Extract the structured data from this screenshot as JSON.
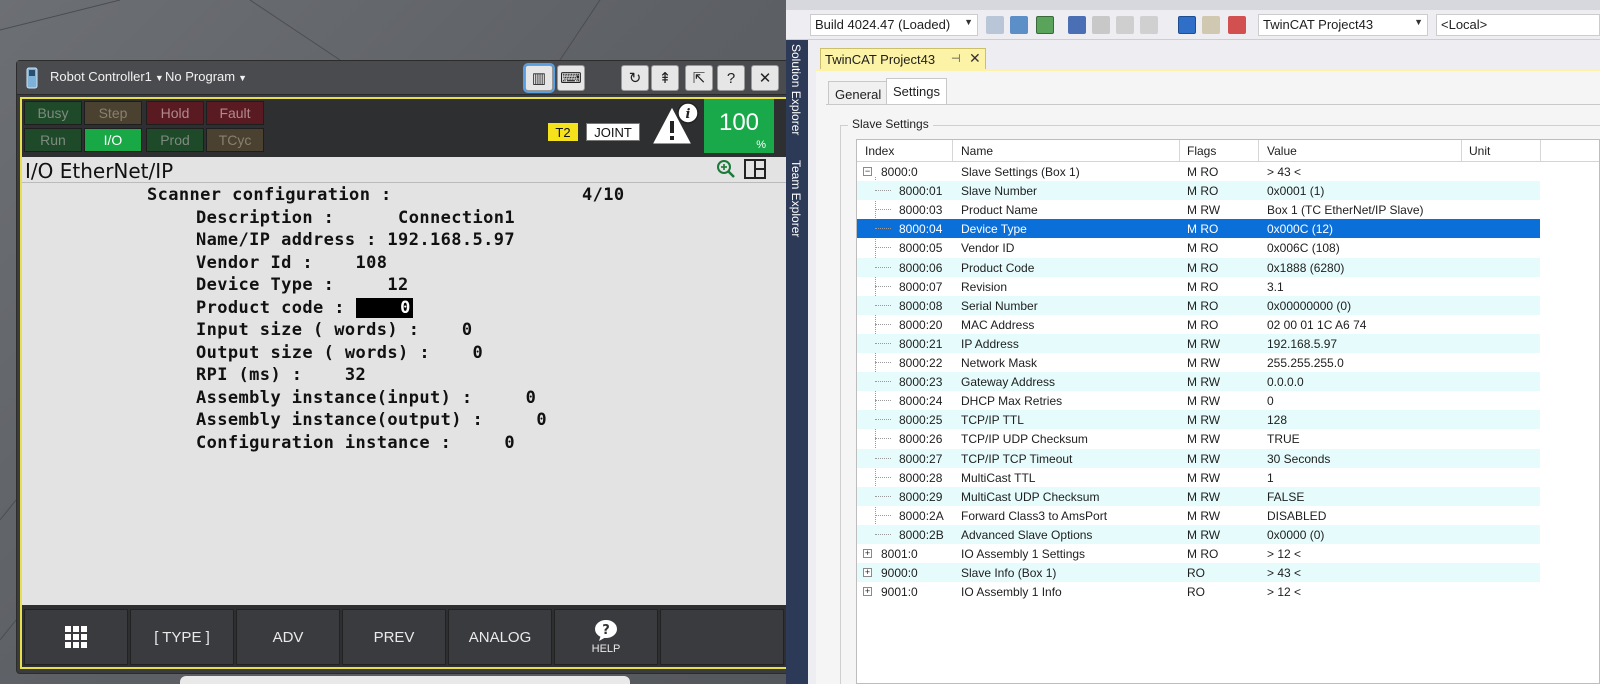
{
  "pendant": {
    "controller_label": "Robot Controller1",
    "program_label": "No Program",
    "leds_row1": [
      {
        "label": "Busy",
        "state": "off-green"
      },
      {
        "label": "Step",
        "state": "off-olive"
      },
      {
        "label": "Hold",
        "state": "off-red"
      },
      {
        "label": "Fault",
        "state": "off-red"
      }
    ],
    "leds_row2": [
      {
        "label": "Run",
        "state": "off-green"
      },
      {
        "label": "I/O",
        "state": "on-green"
      },
      {
        "label": "Prod",
        "state": "off-green"
      },
      {
        "label": "TCyc",
        "state": "off-olive"
      }
    ],
    "mode": "T2",
    "coord": "JOINT",
    "override_value": "100",
    "override_unit": "%",
    "screen_title": "I/O EtherNet/IP",
    "lines": {
      "scanner_label": "Scanner configuration :",
      "scanner_index": "4/10",
      "description": "Description :      Connection1",
      "name_ip": "Name/IP address : 192.168.5.97",
      "vendor_id": "Vendor Id :    108",
      "device_type": "Device Type :     12",
      "product_code_label": "Product code : ",
      "product_code_value": "    0",
      "input_size": "Input size ( words) :    0",
      "output_size": "Output size ( words) :    0",
      "rpi": "RPI (ms) :    32",
      "asm_input": "Assembly instance(input) :     0",
      "asm_output": "Assembly instance(output) :     0",
      "config_instance": "Configuration instance :     0"
    },
    "fkeys": [
      "",
      "[ TYPE ]",
      "ADV",
      "PREV",
      "ANALOG",
      "HELP",
      ""
    ]
  },
  "vs": {
    "build_combo": "Build 4024.47 (Loaded)",
    "project_combo": "TwinCAT Project43",
    "target_combo": "<Local>",
    "side_labels": [
      "Solution Explorer",
      "Team Explorer"
    ],
    "doc_tab": "TwinCAT Project43",
    "prop_tabs": [
      "General",
      "Settings"
    ],
    "group_label": "Slave Settings",
    "columns": [
      "Index",
      "Name",
      "Flags",
      "Value",
      "Unit"
    ],
    "rows": [
      {
        "index": "8000:0",
        "name": "Slave Settings (Box 1)",
        "flags": "M RO",
        "value": "> 43 <",
        "expander": "−",
        "level": 0
      },
      {
        "index": "8000:01",
        "name": "Slave Number",
        "flags": "M RO",
        "value": "0x0001 (1)",
        "level": 1
      },
      {
        "index": "8000:03",
        "name": "Product Name",
        "flags": "M RW",
        "value": "Box 1 (TC EtherNet/IP Slave)",
        "level": 1
      },
      {
        "index": "8000:04",
        "name": "Device Type",
        "flags": "M RO",
        "value": "0x000C (12)",
        "level": 1,
        "selected": true
      },
      {
        "index": "8000:05",
        "name": "Vendor ID",
        "flags": "M RO",
        "value": "0x006C (108)",
        "level": 1
      },
      {
        "index": "8000:06",
        "name": "Product Code",
        "flags": "M RO",
        "value": "0x1888 (6280)",
        "level": 1
      },
      {
        "index": "8000:07",
        "name": "Revision",
        "flags": "M RO",
        "value": "3.1",
        "level": 1
      },
      {
        "index": "8000:08",
        "name": "Serial Number",
        "flags": "M RO",
        "value": "0x00000000 (0)",
        "level": 1
      },
      {
        "index": "8000:20",
        "name": "MAC Address",
        "flags": "M RO",
        "value": "02 00 01 1C A6 74",
        "level": 1
      },
      {
        "index": "8000:21",
        "name": "IP Address",
        "flags": "M RW",
        "value": "192.168.5.97",
        "level": 1
      },
      {
        "index": "8000:22",
        "name": "Network Mask",
        "flags": "M RW",
        "value": "255.255.255.0",
        "level": 1
      },
      {
        "index": "8000:23",
        "name": "Gateway Address",
        "flags": "M RW",
        "value": "0.0.0.0",
        "level": 1
      },
      {
        "index": "8000:24",
        "name": "DHCP Max Retries",
        "flags": "M RW",
        "value": "0",
        "level": 1
      },
      {
        "index": "8000:25",
        "name": "TCP/IP TTL",
        "flags": "M RW",
        "value": "128",
        "level": 1
      },
      {
        "index": "8000:26",
        "name": "TCP/IP UDP Checksum",
        "flags": "M RW",
        "value": "TRUE",
        "level": 1
      },
      {
        "index": "8000:27",
        "name": "TCP/IP TCP Timeout",
        "flags": "M RW",
        "value": "30 Seconds",
        "level": 1
      },
      {
        "index": "8000:28",
        "name": "MultiCast TTL",
        "flags": "M RW",
        "value": "1",
        "level": 1
      },
      {
        "index": "8000:29",
        "name": "MultiCast UDP Checksum",
        "flags": "M RW",
        "value": "FALSE",
        "level": 1
      },
      {
        "index": "8000:2A",
        "name": "Forward Class3 to AmsPort",
        "flags": "M RW",
        "value": "DISABLED",
        "level": 1
      },
      {
        "index": "8000:2B",
        "name": "Advanced Slave Options",
        "flags": "M RW",
        "value": "0x0000 (0)",
        "level": 1
      },
      {
        "index": "8001:0",
        "name": "IO Assembly 1 Settings",
        "flags": "M RO",
        "value": "> 12 <",
        "expander": "+",
        "level": 0
      },
      {
        "index": "9000:0",
        "name": "Slave Info (Box 1)",
        "flags": "RO",
        "value": "> 43 <",
        "expander": "+",
        "level": 0
      },
      {
        "index": "9001:0",
        "name": "IO Assembly 1 Info",
        "flags": "RO",
        "value": "> 12 <",
        "expander": "+",
        "level": 0
      }
    ]
  }
}
